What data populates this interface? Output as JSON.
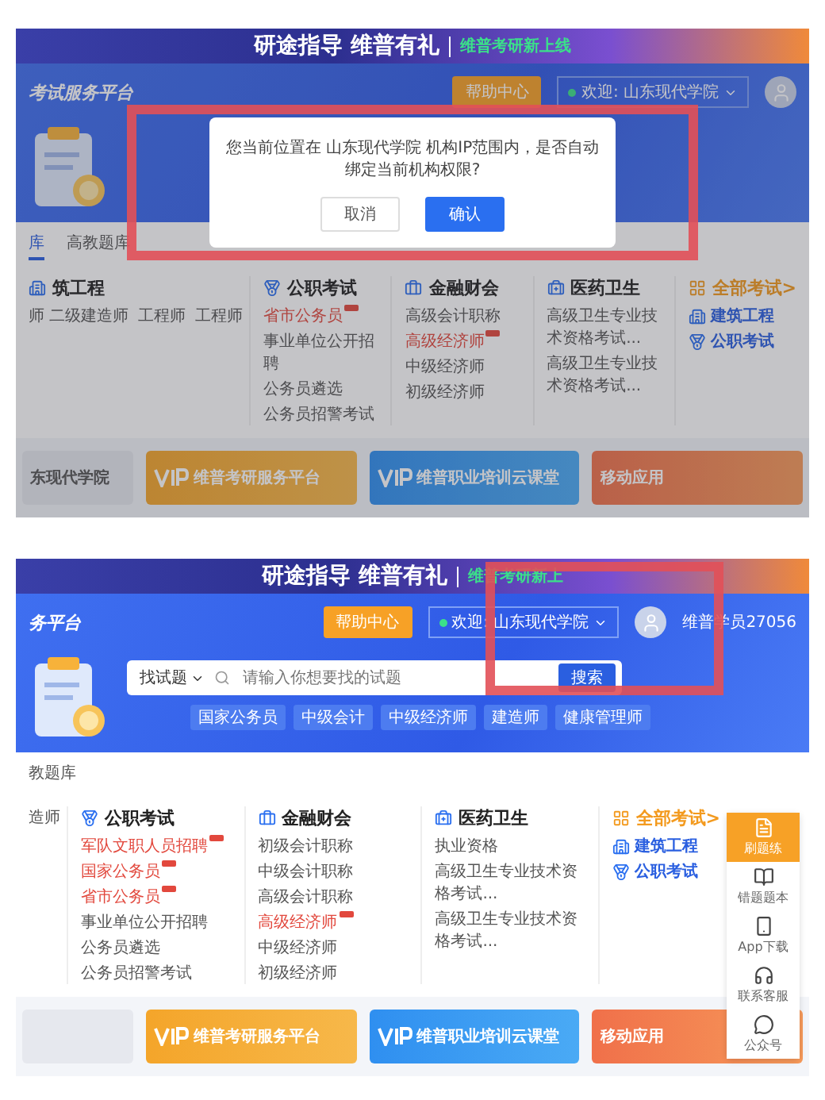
{
  "screens": [
    {
      "banner": {
        "title": "研途指导 维普有礼",
        "tag": "维普考研新上线"
      },
      "header": {
        "site_title": "考试服务平台",
        "help_button": "帮助中心",
        "welcome": "欢迎: 山东现代学院"
      },
      "dialog": {
        "message": "您当前位置在 山东现代学院 机构IP范围内，是否自动绑定当前机构权限?",
        "highlighted": true,
        "buttons": [
          {
            "label": "取消",
            "primary": false
          },
          {
            "label": "确认",
            "primary": true
          }
        ]
      },
      "tabs": [
        {
          "label": "库",
          "selected": true
        },
        {
          "label": "高教题库",
          "selected": false
        }
      ],
      "categories": [
        {
          "kind": "build",
          "title": "筑工程",
          "items": [
            {
              "text": "师 二级建造师",
              "hot": false
            },
            {
              "text": "工程师",
              "hot": false
            },
            {
              "text": "工程师",
              "hot": false
            }
          ]
        },
        {
          "kind": "civil",
          "title": "公职考试",
          "items": [
            {
              "text": "省市公务员",
              "hot": true
            },
            {
              "text": "事业单位公开招聘",
              "hot": false
            },
            {
              "text": "公务员遴选",
              "hot": false
            },
            {
              "text": "公务员招警考试",
              "hot": false
            }
          ]
        },
        {
          "kind": "finance",
          "title": "金融财会",
          "items": [
            {
              "text": "高级会计职称",
              "hot": false
            },
            {
              "text": "高级经济师",
              "hot": true
            },
            {
              "text": "中级经济师",
              "hot": false
            },
            {
              "text": "初级经济师",
              "hot": false
            }
          ]
        },
        {
          "kind": "medical",
          "title": "医药卫生",
          "items": [
            {
              "text": "高级卫生专业技术资格考试...",
              "hot": false
            },
            {
              "text": "高级卫生专业技术资格考试...",
              "hot": false
            }
          ]
        },
        {
          "kind": "all",
          "title": "全部考试>",
          "items": [
            {
              "text": "建筑工程",
              "kind": "build"
            },
            {
              "text": "公职考试",
              "kind": "civil"
            }
          ]
        }
      ],
      "promos": [
        {
          "kind": "school",
          "title": "东现代学院"
        },
        {
          "kind": "vip",
          "title": "维普考研服务平台"
        },
        {
          "kind": "vipblue",
          "title": "维普职业培训云课堂"
        },
        {
          "kind": "app",
          "title": "移动应用"
        }
      ]
    },
    {
      "banner": {
        "title": "研途指导 维普有礼",
        "tag": "维普考研新上"
      },
      "header": {
        "site_title": "务平台",
        "help_button": "帮助中心",
        "welcome": "欢迎: 山东现代学院",
        "user": "维普学员27056",
        "highlighted": true
      },
      "search": {
        "scope": "找试题",
        "placeholder": "请输入你想要找的试题",
        "button": "搜索",
        "hot_tags": [
          "国家公务员",
          "中级会计",
          "中级经济师",
          "建造师",
          "健康管理师"
        ]
      },
      "tabs": [
        {
          "label": "教题库",
          "selected": false
        }
      ],
      "categories": [
        {
          "kind": "build",
          "items": [
            {
              "text": "造师",
              "hot": false
            }
          ]
        },
        {
          "kind": "civil",
          "title": "公职考试",
          "items": [
            {
              "text": "军队文职人员招聘",
              "hot": true
            },
            {
              "text": "国家公务员",
              "hot": true
            },
            {
              "text": "省市公务员",
              "hot": true
            },
            {
              "text": "事业单位公开招聘",
              "hot": false
            },
            {
              "text": "公务员遴选",
              "hot": false
            },
            {
              "text": "公务员招警考试",
              "hot": false
            }
          ]
        },
        {
          "kind": "finance",
          "title": "金融财会",
          "items": [
            {
              "text": "初级会计职称",
              "hot": false
            },
            {
              "text": "中级会计职称",
              "hot": false
            },
            {
              "text": "高级会计职称",
              "hot": false
            },
            {
              "text": "高级经济师",
              "hot": true
            },
            {
              "text": "中级经济师",
              "hot": false
            },
            {
              "text": "初级经济师",
              "hot": false
            }
          ]
        },
        {
          "kind": "medical",
          "title": "医药卫生",
          "items": [
            {
              "text": "执业资格",
              "hot": false
            },
            {
              "text": "高级卫生专业技术资格考试...",
              "hot": false
            },
            {
              "text": "高级卫生专业技术资格考试...",
              "hot": false
            }
          ]
        },
        {
          "kind": "all",
          "title": "全部考试>",
          "items": [
            {
              "text": "建筑工程",
              "kind": "build"
            },
            {
              "text": "公职考试",
              "kind": "civil"
            }
          ]
        }
      ],
      "promos": [
        {
          "kind": "school"
        },
        {
          "kind": "vip",
          "title": "维普考研服务平台"
        },
        {
          "kind": "vipblue",
          "title": "维普职业培训云课堂"
        },
        {
          "kind": "app",
          "title": "移动应用"
        }
      ],
      "sidebar": [
        {
          "kind": "practice",
          "label": "刷题练",
          "selected": true
        },
        {
          "kind": "book",
          "label": "错题题本",
          "selected": false
        },
        {
          "kind": "phone",
          "label": "App下载",
          "selected": false
        },
        {
          "kind": "service",
          "label": "联系客服",
          "selected": false
        },
        {
          "kind": "wechat",
          "label": "公众号",
          "selected": false
        }
      ]
    }
  ]
}
